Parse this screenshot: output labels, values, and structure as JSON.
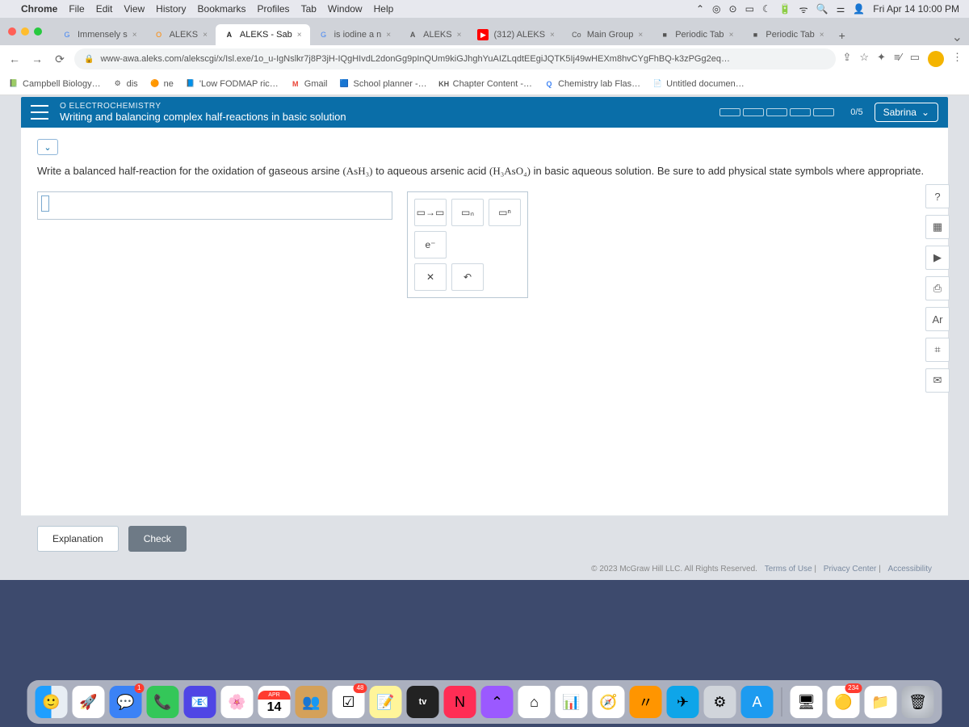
{
  "menubar": {
    "app": "Chrome",
    "items": [
      "File",
      "Edit",
      "View",
      "History",
      "Bookmarks",
      "Profiles",
      "Tab",
      "Window",
      "Help"
    ],
    "clock": "Fri Apr 14  10:00 PM",
    "status_icons": [
      "control-center",
      "target",
      "record",
      "moon",
      "battery",
      "wifi",
      "search",
      "toggles",
      "user"
    ]
  },
  "browser": {
    "tabs": [
      {
        "fav": "G",
        "label": "Immensely s",
        "active": false
      },
      {
        "fav": "O",
        "label": "ALEKS",
        "active": false
      },
      {
        "fav": "A",
        "label": "ALEKS - Sab",
        "active": true
      },
      {
        "fav": "G",
        "label": "is iodine a n",
        "active": false
      },
      {
        "fav": "A",
        "label": "ALEKS",
        "active": false
      },
      {
        "fav": "▶",
        "label": "(312) ALEKS",
        "active": false
      },
      {
        "fav": "Co",
        "label": "Main Group",
        "active": false
      },
      {
        "fav": "■",
        "label": "Periodic Tab",
        "active": false
      },
      {
        "fav": "■",
        "label": "Periodic Tab",
        "active": false
      }
    ],
    "url": "www-awa.aleks.com/alekscgi/x/Isl.exe/1o_u-IgNslkr7j8P3jH-IQgHIvdL2donGg9pInQUm9kiGJhghYuAIZLqdtEEgiJQTK5Ij49wHEXm8hvCYgFhBQ-k3zPGg2eq…",
    "bookmarks": [
      {
        "ico": "📗",
        "label": "Campbell Biology…"
      },
      {
        "ico": "⚙",
        "label": "dis"
      },
      {
        "ico": "🟠",
        "label": "ne"
      },
      {
        "ico": "📘",
        "label": "'Low FODMAP ric…"
      },
      {
        "ico": "M",
        "label": "Gmail"
      },
      {
        "ico": "🟦",
        "label": "School planner -…"
      },
      {
        "ico": "KH",
        "label": "Chapter Content -…"
      },
      {
        "ico": "Q",
        "label": "Chemistry lab Flas…"
      },
      {
        "ico": "📄",
        "label": "Untitled documen…"
      }
    ]
  },
  "aleks": {
    "topic_label": "O ELECTROCHEMISTRY",
    "title": "Writing and balancing complex half-reactions in basic solution",
    "progress": "0/5",
    "user": "Sabrina",
    "prompt_pre": "Write a balanced half-reaction for the oxidation of gaseous arsine ",
    "formula1": "(AsH₃)",
    "prompt_mid": " to aqueous arsenic acid ",
    "formula2": "(H₃AsO₄)",
    "prompt_post": " in basic aqueous solution. Be sure to add physical state symbols where appropriate.",
    "tools": {
      "arrow": "▭→▭",
      "sub": "▭ₙ",
      "sup": "▭ⁿ",
      "e": "e⁻",
      "clear": "✕",
      "undo": "↶"
    },
    "side": {
      "help": "?",
      "calc": "▦",
      "video": "▶",
      "clipboard": "⎙",
      "periodic": "Ar",
      "keypad": "⌗",
      "chat": "✉"
    },
    "explanation_btn": "Explanation",
    "check_btn": "Check",
    "copyright": "© 2023 McGraw Hill LLC. All Rights Reserved.",
    "links": {
      "terms": "Terms of Use",
      "privacy": "Privacy Center",
      "access": "Accessibility"
    }
  },
  "dock": {
    "cal_month": "APR",
    "cal_day": "14",
    "badge1": "1",
    "badge2": "48",
    "badge3": "234",
    "tv": "tv"
  }
}
